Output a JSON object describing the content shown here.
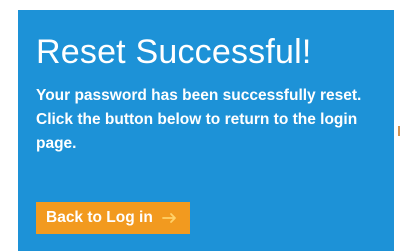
{
  "dialog": {
    "title": "Reset Successful!",
    "message": "Your password has been successfully reset. Click the button below to return to the login page.",
    "back_button_label": "Back to Log in",
    "back_button_icon": "arrow-right-icon"
  },
  "colors": {
    "panel_background": "#1d92d7",
    "button_background": "#f29a1f",
    "text": "#ffffff",
    "arrow": "#ffd26a"
  }
}
